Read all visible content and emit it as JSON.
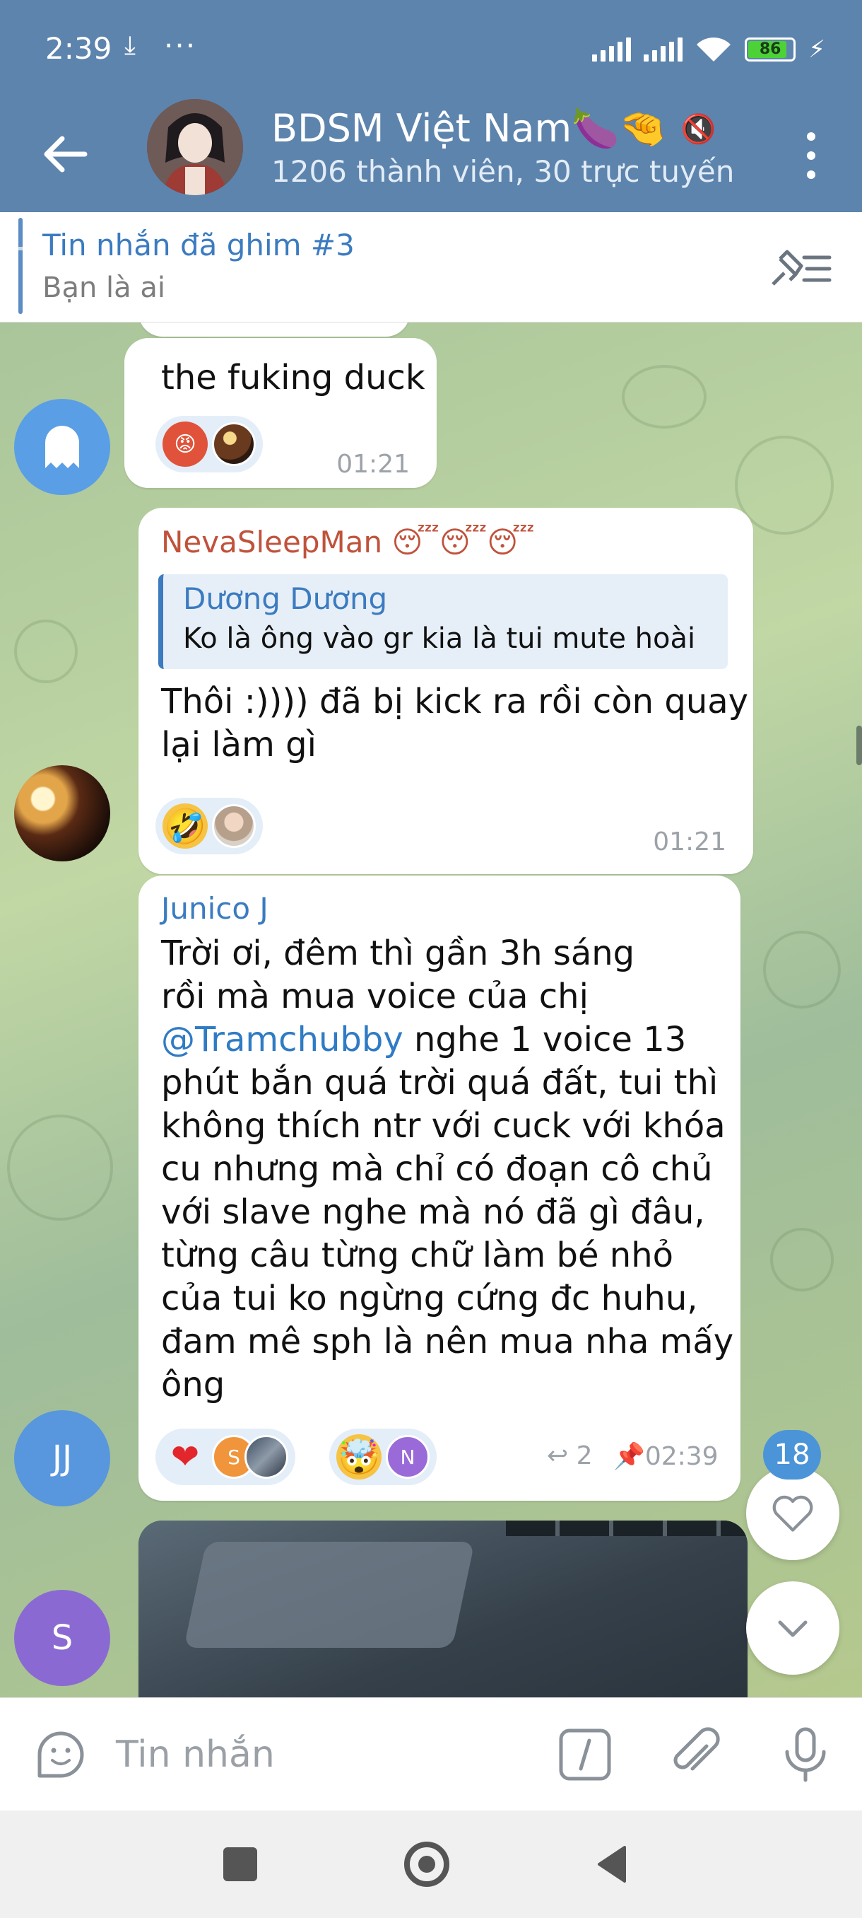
{
  "status": {
    "time": "2:39",
    "battery": "86"
  },
  "header": {
    "title": "BDSM Việt Nam🍆🤏",
    "subtitle": "1206 thành viên, 30 trực tuyến"
  },
  "pinned": {
    "title": "Tin nhắn đã ghim #3",
    "text": "Bạn là ai"
  },
  "messages": [
    {
      "text": "the fuking duck",
      "time": "01:21"
    },
    {
      "sender": "NevaSleepMan 😴😴😴",
      "reply_author": "Dương Dương",
      "reply_text": "Ko là ông vào gr kia là tui mute hoài",
      "text_line1": "Thôi :)))) đã bị kick ra rồi còn quay",
      "text_line2": "lại làm gì",
      "time": "01:21"
    },
    {
      "sender": "Junico J",
      "lines": [
        "Trời ơi, đêm thì gần 3h sáng",
        "rồi mà mua voice của chị",
        "@Tramchubby",
        " nghe 1 voice 13",
        "phút bắn quá trời quá đất, tui thì",
        "không thích ntr với cuck với khóa",
        "cu nhưng mà chỉ có đoạn cô chủ",
        "với slave nghe mà nó đã gì đâu,",
        "từng câu từng chữ làm bé nhỏ",
        "của tui ko ngừng cứng đc huhu,",
        "đam mê sph là nên mua nha mấy",
        "ông"
      ],
      "replies": "2",
      "time": "02:39",
      "avatar_initials": "JJ",
      "reactor1": "S",
      "reactor2": "N"
    }
  ],
  "avatars": {
    "s_initial": "S"
  },
  "unread_badge": "18",
  "input": {
    "placeholder": "Tin nhắn"
  },
  "colors": {
    "header_bg": "#5d84ad",
    "accent": "#3b7bc0",
    "sender_red": "#c0523b",
    "sender_blue": "#3b7bc0"
  }
}
